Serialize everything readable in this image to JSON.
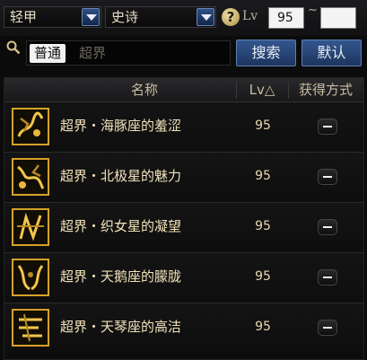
{
  "filter": {
    "armor_type": "轻甲",
    "rarity": "史诗",
    "help": "?",
    "lv_label": "Lv",
    "lv_min": "95",
    "lv_sep": "~",
    "lv_max": ""
  },
  "search": {
    "mode": "普通",
    "placeholder": "超界",
    "search_button": "搜索",
    "default_button": "默认"
  },
  "table": {
    "headers": {
      "name": "名称",
      "level": "Lv△",
      "acquire": "获得方式"
    },
    "rows": [
      {
        "name": "超界・海豚座的羞涩",
        "level": "95",
        "icon": "epic-gold-pattern-icon"
      },
      {
        "name": "超界・北极星的魅力",
        "level": "95",
        "icon": "epic-gold-pattern-icon"
      },
      {
        "name": "超界・织女星的凝望",
        "level": "95",
        "icon": "epic-gold-pattern-icon"
      },
      {
        "name": "超界・天鹅座的朦胧",
        "level": "95",
        "icon": "epic-gold-pattern-icon"
      },
      {
        "name": "超界・天琴座的高洁",
        "level": "95",
        "icon": "epic-gold-pattern-icon"
      }
    ]
  },
  "colors": {
    "accent_blue": "#2f4f86",
    "item_gold": "#d4a22a",
    "text_cream": "#f0e2b9"
  }
}
